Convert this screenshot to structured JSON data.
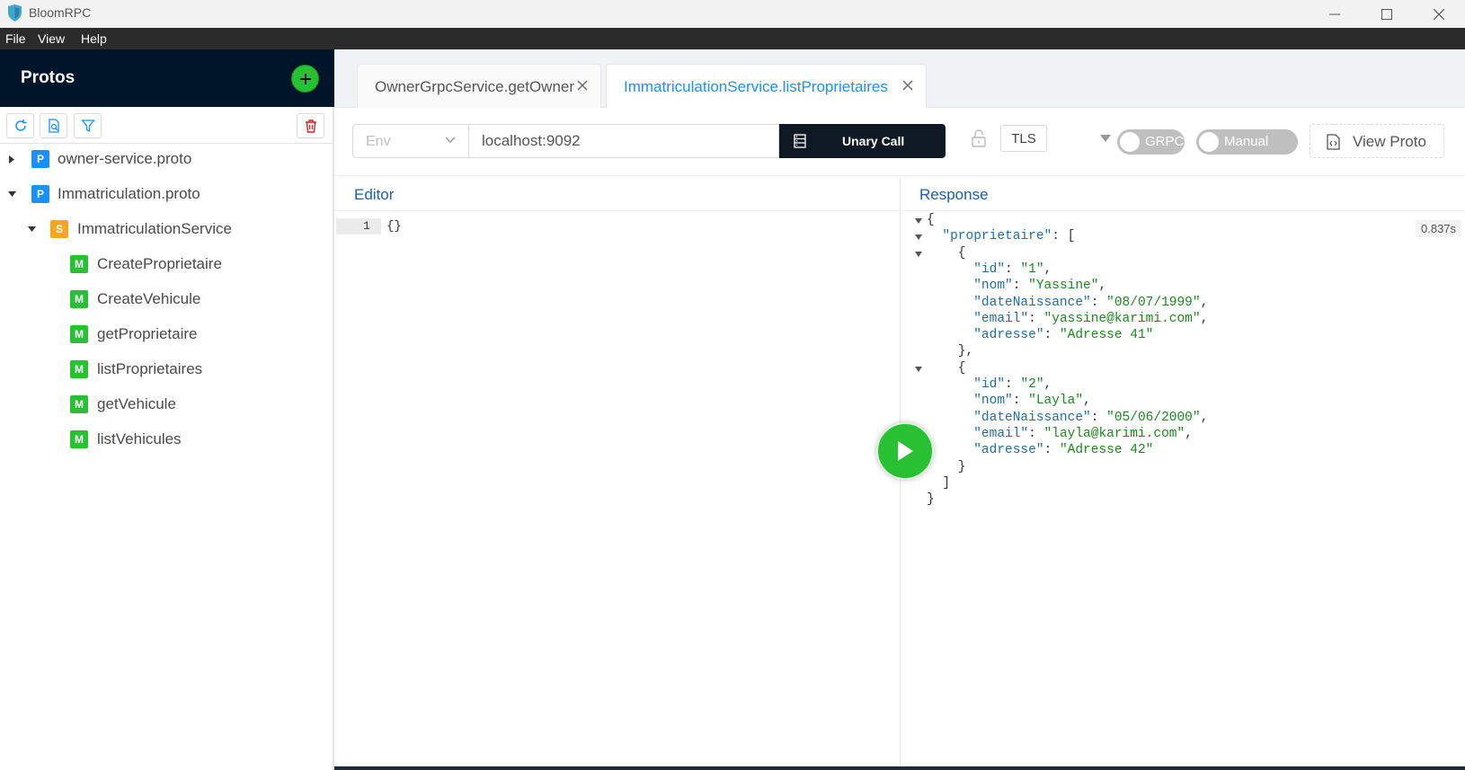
{
  "window": {
    "title": "BloomRPC",
    "brand_color": "#3fa8c8"
  },
  "menu": [
    "File",
    "View",
    "Help"
  ],
  "sidebar": {
    "title": "Protos",
    "tree": [
      {
        "type": "proto",
        "tag": "P",
        "label": "owner-service.proto",
        "expanded": false
      },
      {
        "type": "proto",
        "tag": "P",
        "label": "Immatriculation.proto",
        "expanded": true
      },
      {
        "type": "service",
        "tag": "S",
        "label": "ImmatriculationService",
        "expanded": true
      },
      {
        "type": "method",
        "tag": "M",
        "label": "CreateProprietaire"
      },
      {
        "type": "method",
        "tag": "M",
        "label": "CreateVehicule"
      },
      {
        "type": "method",
        "tag": "M",
        "label": "getProprietaire"
      },
      {
        "type": "method",
        "tag": "M",
        "label": "listProprietaires"
      },
      {
        "type": "method",
        "tag": "M",
        "label": "getVehicule"
      },
      {
        "type": "method",
        "tag": "M",
        "label": "listVehicules"
      }
    ]
  },
  "tabs": [
    {
      "label": "OwnerGrpcService.getOwner",
      "active": false
    },
    {
      "label": "ImmatriculationService.listProprietaires",
      "active": true
    }
  ],
  "controls": {
    "env_placeholder": "Env",
    "url": "localhost:9092",
    "call_label": "Unary Call",
    "tls_label": "TLS",
    "grpc_toggle": "GRPC",
    "manual_toggle": "Manual",
    "view_proto_label": "View Proto"
  },
  "editor": {
    "title": "Editor",
    "line_number": "1",
    "content": "{}"
  },
  "response": {
    "title": "Response",
    "time": "0.837s",
    "lines": [
      {
        "fold": true,
        "parts": [
          [
            "p",
            "{"
          ]
        ]
      },
      {
        "fold": true,
        "parts": [
          [
            "p",
            "  "
          ],
          [
            "k",
            "\"proprietaire\""
          ],
          [
            "p",
            ": ["
          ]
        ]
      },
      {
        "fold": true,
        "parts": [
          [
            "p",
            "    {"
          ]
        ]
      },
      {
        "fold": false,
        "parts": [
          [
            "p",
            "      "
          ],
          [
            "k",
            "\"id\""
          ],
          [
            "p",
            ": "
          ],
          [
            "s",
            "\"1\""
          ],
          [
            "p",
            ","
          ]
        ]
      },
      {
        "fold": false,
        "parts": [
          [
            "p",
            "      "
          ],
          [
            "k",
            "\"nom\""
          ],
          [
            "p",
            ": "
          ],
          [
            "s",
            "\"Yassine\""
          ],
          [
            "p",
            ","
          ]
        ]
      },
      {
        "fold": false,
        "parts": [
          [
            "p",
            "      "
          ],
          [
            "k",
            "\"dateNaissance\""
          ],
          [
            "p",
            ": "
          ],
          [
            "s",
            "\"08/07/1999\""
          ],
          [
            "p",
            ","
          ]
        ]
      },
      {
        "fold": false,
        "parts": [
          [
            "p",
            "      "
          ],
          [
            "k",
            "\"email\""
          ],
          [
            "p",
            ": "
          ],
          [
            "s",
            "\"yassine@karimi.com\""
          ],
          [
            "p",
            ","
          ]
        ]
      },
      {
        "fold": false,
        "parts": [
          [
            "p",
            "      "
          ],
          [
            "k",
            "\"adresse\""
          ],
          [
            "p",
            ": "
          ],
          [
            "s",
            "\"Adresse 41\""
          ]
        ]
      },
      {
        "fold": false,
        "parts": [
          [
            "p",
            "    },"
          ]
        ]
      },
      {
        "fold": true,
        "parts": [
          [
            "p",
            "    {"
          ]
        ]
      },
      {
        "fold": false,
        "parts": [
          [
            "p",
            "      "
          ],
          [
            "k",
            "\"id\""
          ],
          [
            "p",
            ": "
          ],
          [
            "s",
            "\"2\""
          ],
          [
            "p",
            ","
          ]
        ]
      },
      {
        "fold": false,
        "parts": [
          [
            "p",
            "      "
          ],
          [
            "k",
            "\"nom\""
          ],
          [
            "p",
            ": "
          ],
          [
            "s",
            "\"Layla\""
          ],
          [
            "p",
            ","
          ]
        ]
      },
      {
        "fold": false,
        "parts": [
          [
            "p",
            "      "
          ],
          [
            "k",
            "\"dateNaissance\""
          ],
          [
            "p",
            ": "
          ],
          [
            "s",
            "\"05/06/2000\""
          ],
          [
            "p",
            ","
          ]
        ]
      },
      {
        "fold": false,
        "parts": [
          [
            "p",
            "      "
          ],
          [
            "k",
            "\"email\""
          ],
          [
            "p",
            ": "
          ],
          [
            "s",
            "\"layla@karimi.com\""
          ],
          [
            "p",
            ","
          ]
        ]
      },
      {
        "fold": false,
        "parts": [
          [
            "p",
            "      "
          ],
          [
            "k",
            "\"adresse\""
          ],
          [
            "p",
            ": "
          ],
          [
            "s",
            "\"Adresse 42\""
          ]
        ]
      },
      {
        "fold": false,
        "parts": [
          [
            "p",
            "    }"
          ]
        ]
      },
      {
        "fold": false,
        "parts": [
          [
            "p",
            "  ]"
          ]
        ]
      },
      {
        "fold": false,
        "parts": [
          [
            "p",
            "}"
          ]
        ]
      }
    ]
  },
  "colors": {
    "sidebar_header": "#001529",
    "accent_blue": "#1890ff",
    "method_green": "#27c133",
    "proto_blue": "#1890ff",
    "service_orange": "#f5a623"
  }
}
